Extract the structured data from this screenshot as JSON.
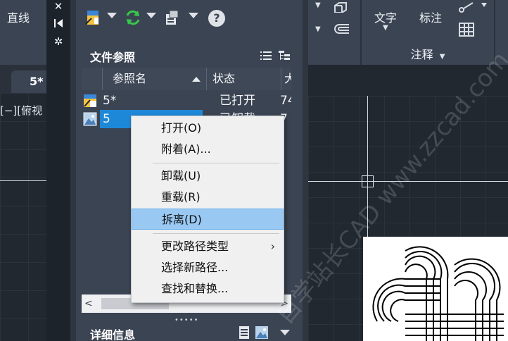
{
  "left": {
    "ribbon_label": "直线",
    "tab_label": "5*",
    "view_label": "[−][俯视"
  },
  "palette": {
    "section_file_title": "文件参照",
    "section_detail_title": "详细信息",
    "help_label": "?",
    "columns": [
      "参照名",
      "状态",
      "大"
    ],
    "rows": [
      {
        "name": "5*",
        "status": "已打开",
        "size": "74",
        "icon": "drawing-file-icon"
      },
      {
        "name": "5",
        "status": "已卸载",
        "size": "7",
        "icon": "image-file-icon",
        "selected": true
      }
    ]
  },
  "context_menu": {
    "items": [
      {
        "label": "打开(O)"
      },
      {
        "label": "附着(A)..."
      },
      {
        "label": "卸载(U)"
      },
      {
        "label": "重载(R)"
      },
      {
        "label": "拆离(D)",
        "highlighted": true
      },
      {
        "label": "更改路径类型",
        "submenu": true
      },
      {
        "label": "选择新路径..."
      },
      {
        "label": "查找和替换..."
      }
    ]
  },
  "right": {
    "text_label": "文字",
    "dim_label": "标注",
    "annot_label": "注释"
  },
  "watermark": "自学站长CAD  www.zzcad.com",
  "colors": {
    "panel_bg": "#3b4453",
    "selection": "#1e88d8",
    "menu_highlight": "#99c9f3",
    "canvas_bg": "#212830"
  }
}
